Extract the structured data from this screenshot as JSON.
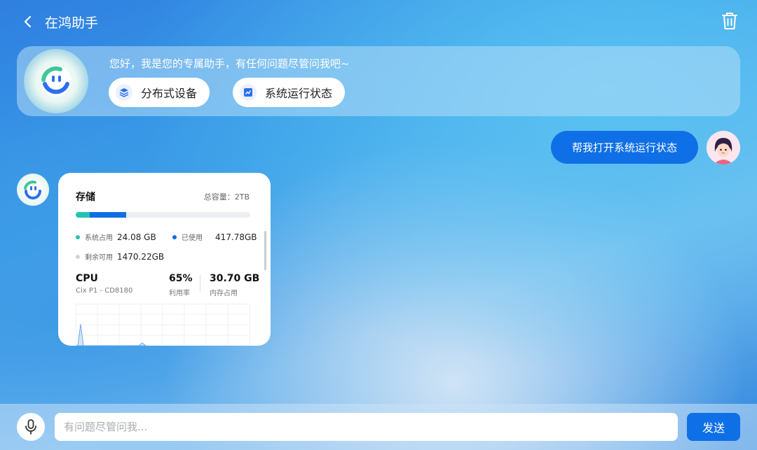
{
  "header": {
    "title": "在鸿助手",
    "back_icon": "chevron-left-icon",
    "trash_icon": "trash-icon"
  },
  "welcome": {
    "greeting": "您好，我是您的专属助手，有任何问题尽管问我吧~",
    "chips": [
      {
        "label": "分布式设备",
        "icon": "layers-icon"
      },
      {
        "label": "系统运行状态",
        "icon": "chart-icon"
      }
    ]
  },
  "chat": {
    "user_message": "帮我打开系统运行状态"
  },
  "status_card": {
    "storage": {
      "title": "存储",
      "total": "总容量：2TB",
      "system_fraction": 0.012,
      "used_fraction": 0.209,
      "system_label": "系统占用",
      "system_value": "24.08 GB",
      "used_label": "已使用",
      "used_value": "417.78GB",
      "free_label": "剩余可用",
      "free_value": "1470.22GB",
      "colors": {
        "system": "#22c3b0",
        "used": "#0f6fe6",
        "free": "#d0d2d6"
      }
    },
    "cpu": {
      "title": "CPU",
      "model": "Cix P1 - CD8180",
      "usage_value": "65%",
      "usage_label": "利用率",
      "memory_value": "30.70 GB",
      "memory_label": "内存占用"
    }
  },
  "composer": {
    "placeholder": "有问题尽管问我...",
    "send_label": "发送",
    "mic_icon": "microphone-icon"
  },
  "accent_color": "#0f6fe6"
}
